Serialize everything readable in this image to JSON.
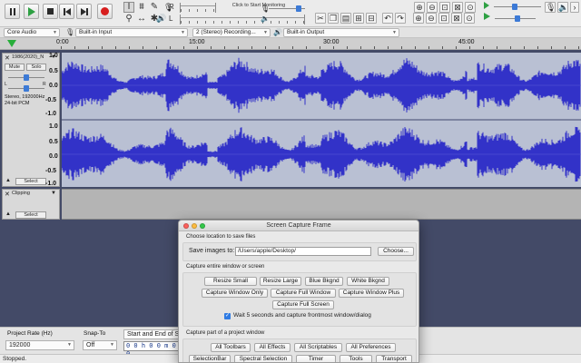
{
  "toolbar": {
    "monitor_text": "Click to Start Monitoring",
    "meter_record_label": "R",
    "meter_play_label": "L",
    "playback_meter_ticks": "-57 -54 -51 -48 -45 -42 -3 -18 -15 -12 -9 -6 -3 0"
  },
  "devices": {
    "host": "Core Audio",
    "recording_device": "Built-in Input",
    "channels": "2 (Stereo) Recording...",
    "playback_device": "Built-in Output"
  },
  "timeline": {
    "labels": [
      "0:00",
      "15:00",
      "30:00",
      "45:00"
    ]
  },
  "tracks": [
    {
      "name": "1986(2020)_N",
      "mute_label": "Mute",
      "solo_label": "Solo",
      "pan_left": "L",
      "pan_right": "R",
      "info_line1": "Stereo, 192000Hz",
      "info_line2": "24-bit PCM",
      "select_label": "Select",
      "scale_ch1": [
        "1.0",
        "0.5",
        "0.0",
        "-0.5",
        "-1.0"
      ],
      "scale_ch2": [
        "1.0",
        "0.5",
        "0.0",
        "-0.5",
        "-1.0"
      ],
      "wave_color": "#3232c8"
    },
    {
      "name": "Clipping",
      "select_label": "Select"
    }
  ],
  "bottom": {
    "project_rate_label": "Project Rate (Hz)",
    "project_rate_value": "192000",
    "snap_label": "Snap-To",
    "snap_value": "Off",
    "selection_label": "Start and End of S",
    "time_value": "0 0 h 0 0 m 0 0"
  },
  "status": {
    "text": "Stopped."
  },
  "dialog": {
    "title": "Screen Capture Frame",
    "section1": "Choose location to save files",
    "save_label": "Save images to:",
    "save_path": "/Users/apple/Desktop/",
    "choose_label": "Choose...",
    "section2": "Capture entire window or screen",
    "row1": [
      "Resize Small",
      "Resize Large",
      "Blue Bkgnd",
      "White Bkgnd"
    ],
    "row2": [
      "Capture Window Only",
      "Capture Full Window",
      "Capture Window Plus"
    ],
    "full_screen": "Capture Full Screen",
    "wait_label": "Wait 5 seconds and capture frontmost window/dialog",
    "section3": "Capture part of a project window",
    "row3": [
      "All Toolbars",
      "All Effects",
      "All Scriptables",
      "All Preferences"
    ],
    "row4": [
      "SelectionBar",
      "Spectral Selection",
      "Timer",
      "Tools",
      "Transport"
    ]
  }
}
